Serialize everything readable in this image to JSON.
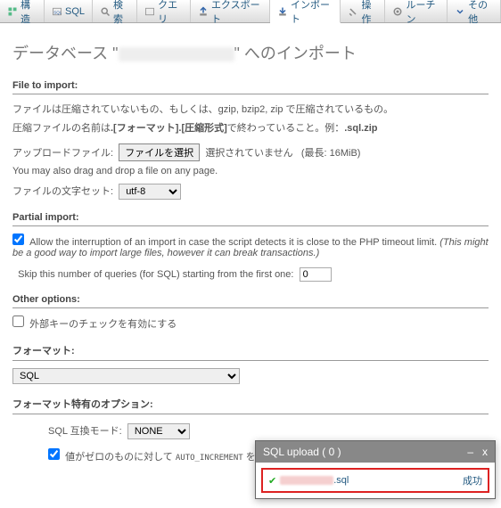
{
  "tabs": {
    "structure": "構造",
    "sql": "SQL",
    "search": "検索",
    "query": "クエリ",
    "export": "エクスポート",
    "import": "インポート",
    "operations": "操作",
    "routines": "ルーチン",
    "more": "その他"
  },
  "title_pre": "データベース \"",
  "title_post": "\" へのインポート",
  "file_to_import": {
    "heading": "File to import:",
    "desc1": "ファイルは圧縮されていないもの、もしくは、gzip, bzip2, zip で圧縮されているもの。",
    "desc2_a": "圧縮ファイルの名前は",
    "desc2_b": ".[フォーマット].[圧縮形式]",
    "desc2_c": "で終わっていること。例：",
    "desc2_d": ".sql.zip",
    "upload_label": "アップロードファイル:",
    "choose_btn": "ファイルを選択",
    "not_selected": "選択されていません",
    "maxsize": "(最長: 16MiB)",
    "dragdrop": "You may also drag and drop a file on any page.",
    "charset_label": "ファイルの文字セット:",
    "charset_value": "utf-8"
  },
  "partial": {
    "heading": "Partial import:",
    "allow_label_a": "Allow the interruption of an import in case the script detects it is close to the PHP timeout limit. ",
    "allow_label_b": "(This might be a good way to import large files, however it can break transactions.)",
    "skip_label": "Skip this number of queries (for SQL) starting from the first one:",
    "skip_value": "0"
  },
  "other": {
    "heading": "Other options:",
    "fk_label": "外部キーのチェックを有効にする"
  },
  "format": {
    "heading": "フォーマット:",
    "value": "SQL"
  },
  "format_opts": {
    "heading": "フォーマット特有のオプション:",
    "compat_label": "SQL 互換モード:",
    "compat_value": "NONE",
    "zero_a": "値がゼロのものに対して ",
    "zero_code": "AUTO_INCREMENT",
    "zero_b": " を使用し"
  },
  "popup": {
    "title": "SQL upload ( 0 )",
    "min": "–",
    "close": "x",
    "ext": ".sql",
    "status": "成功"
  }
}
